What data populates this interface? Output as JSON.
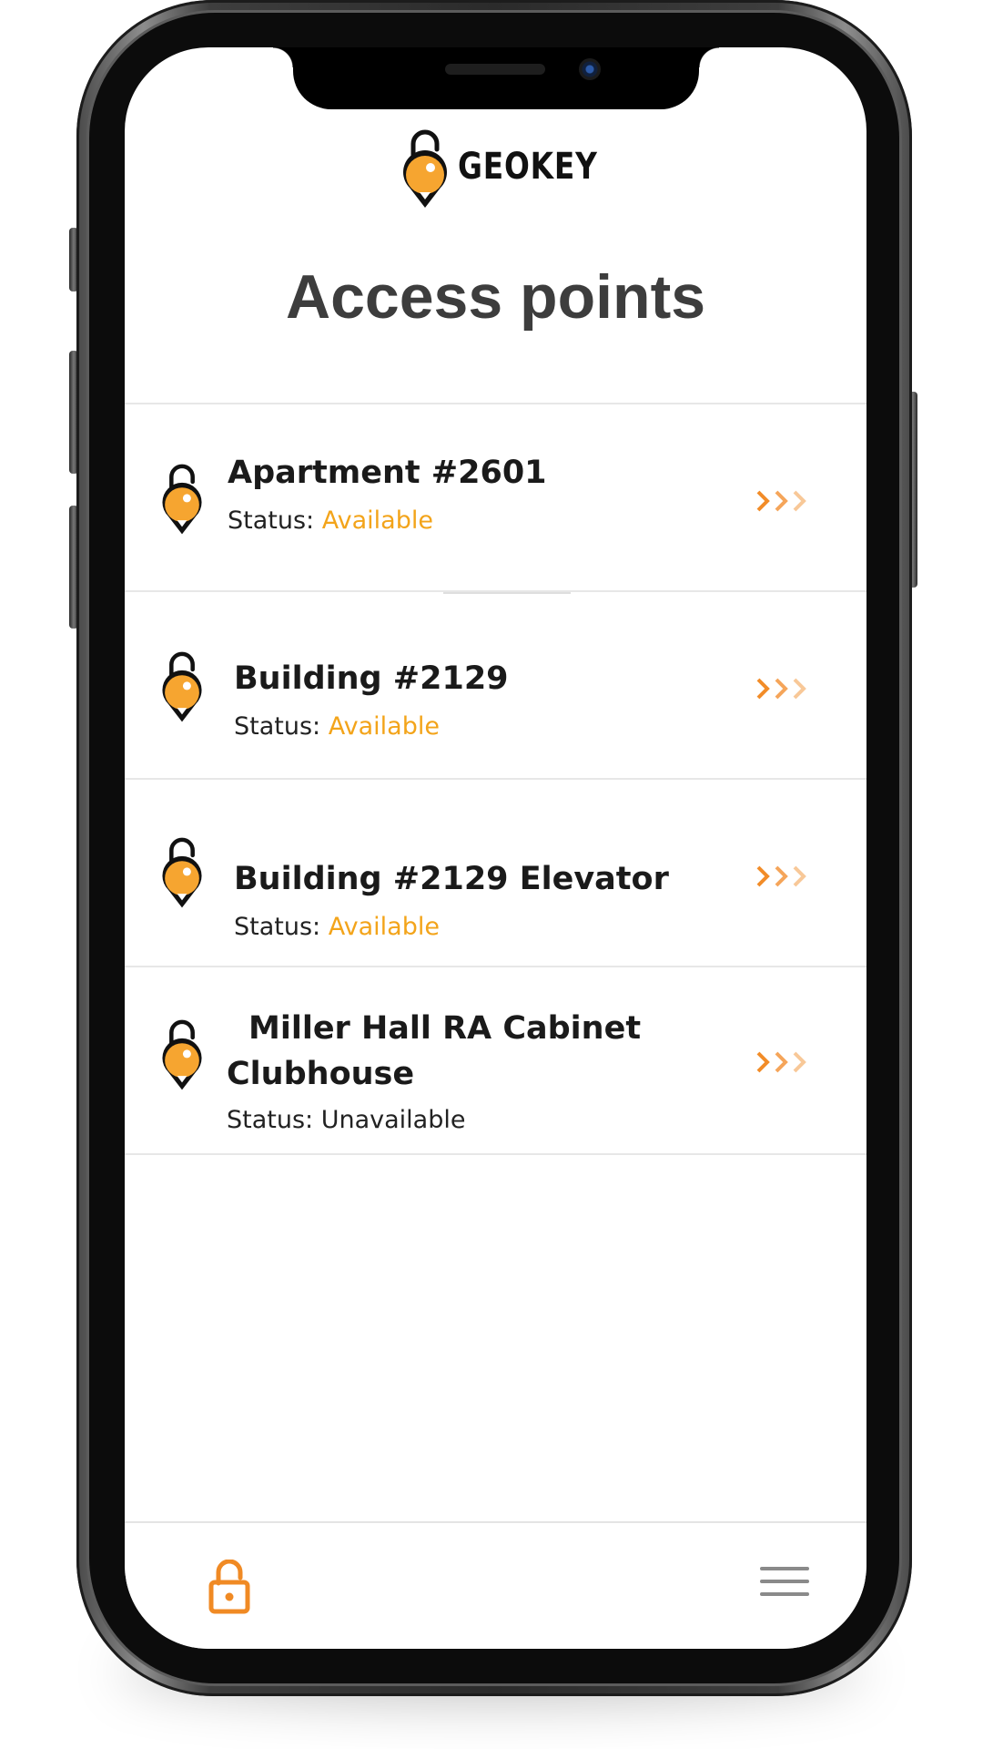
{
  "app": {
    "brand": "GEOKEY"
  },
  "page": {
    "title": "Access points"
  },
  "colors": {
    "accent": "#F3A41A",
    "chevron": "#F28C28",
    "text": "#1A1A1A"
  },
  "access_points": [
    {
      "name": "Apartment #2601",
      "status_label": "Status:",
      "status_value": "Available",
      "available": true
    },
    {
      "name": "Building #2129",
      "status_label": "Status:",
      "status_value": "Available",
      "available": true
    },
    {
      "name": "Building #2129 Elevator",
      "status_label": "Status:",
      "status_value": "Available",
      "available": true
    },
    {
      "name_line1": "Miller Hall RA Cabinet",
      "name_line2": "Clubhouse",
      "status_label": "Status:",
      "status_value": "Unavailable",
      "available": false
    }
  ],
  "bottom_nav": {
    "left_icon": "lock-icon",
    "right_icon": "hamburger-menu-icon"
  }
}
